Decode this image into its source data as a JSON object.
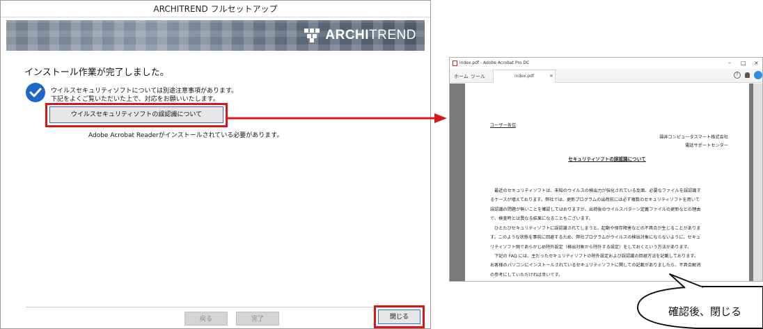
{
  "installer": {
    "title": "ARCHITREND フルセットアップ",
    "brand_prefix": "ARCHI",
    "brand_suffix": "TREND",
    "complete_message": "インストール作業が完了しました。",
    "notice_line1": "ウイルスセキュリティソフトについては別途注意事項があります。",
    "notice_line2": "下記をよくご覧いただいた上で、対応をお願いいたします。",
    "security_button_label": "ウイルスセキュリティソフトの誤認識について",
    "reader_note": "Adobe Acrobat Readerがインストールされている必要があります。",
    "back_label": "戻る",
    "finish_label": "完了",
    "close_label": "閉じる",
    "highlight_color": "#d9161c"
  },
  "acrobat": {
    "window_title": "index.pdf - Adobe Acrobat Pro DC",
    "tab_home": "ホーム",
    "tab_tools": "ツール",
    "tab_doc": "index.pdf",
    "tab_close": "×",
    "win_min": "–",
    "win_max": "□",
    "win_close": "×",
    "help": "?",
    "page": {
      "to": "ユーザー各位",
      "company": "福井コンピュータスマート株式会社",
      "center": "電話サポートセンター",
      "title": "セキュリティソフトの誤認識について",
      "p1_l1": "　最近のセキュリティソフトは、未知のウイルスの検出力が強化されている反面、必要なファイルを誤認識す",
      "p1_l2": "るケースが増えております。弊社では、更新プログラムの出荷前には必ず複数のセキュリティソフトを用いて",
      "p1_l3": "誤認識の問題が無いことを確認してはおりますが、出荷後のウイルスパターン定義ファイルの更新などの理由",
      "p1_l4": "で、検査時とは異なる結果になることもございます。",
      "p2_l1": "　ひとたびセキュリティソフトに誤認識されてしまうと、起動や保存障害などの不具合が生じることがありま",
      "p2_l2": "す。このような状態を事前に回避するため、弊社プログラムがウイルスの検出対象にならないように、セキュ",
      "p2_l3": "リティソフト側であらかじめ除外設定（検出対象から除外する設定）をしておくという方法があります。",
      "p3_l1": "　下記の FAQ には、主だったセキュリティソフトの除外設定および誤認識の回避方法を記載しております。",
      "p3_l2": "お客様のパソコンにインストールされているセキュリティソフトに関しての記載がありましたら、不具合解消",
      "p3_l3": "の参考にしていただければ幸いです。"
    }
  },
  "callout": {
    "text": "確認後、閉じる"
  }
}
